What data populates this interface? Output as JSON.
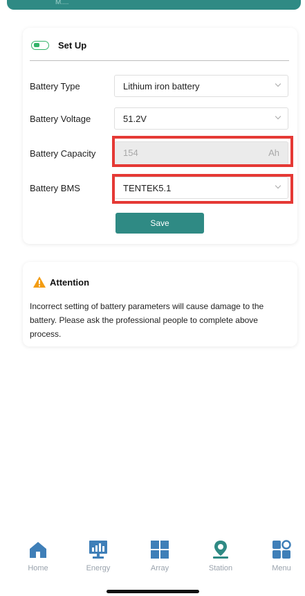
{
  "header": {
    "title": "M...."
  },
  "setup": {
    "title": "Set Up",
    "battery_type": {
      "label": "Battery Type",
      "value": "Lithium iron battery"
    },
    "battery_voltage": {
      "label": "Battery Voltage",
      "value": "51.2V"
    },
    "battery_capacity": {
      "label": "Battery Capacity",
      "value": "154",
      "unit": "Ah"
    },
    "battery_bms": {
      "label": "Battery BMS",
      "value": "TENTEK5.1"
    },
    "save_label": "Save"
  },
  "attention": {
    "title": "Attention",
    "text": "Incorrect setting of battery parameters will cause damage to the battery. Please ask the professional people to complete above process."
  },
  "nav": {
    "items": [
      {
        "label": "Home",
        "icon": "home-icon",
        "color": "#3f7fb8"
      },
      {
        "label": "Energy",
        "icon": "energy-icon",
        "color": "#3f7fb8"
      },
      {
        "label": "Array",
        "icon": "array-icon",
        "color": "#3f7fb8"
      },
      {
        "label": "Station",
        "icon": "station-icon",
        "color": "#2f8a84"
      },
      {
        "label": "Menu",
        "icon": "menu-icon",
        "color": "#3f7fb8"
      }
    ]
  },
  "colors": {
    "primary": "#2f8a84",
    "toggle_green": "#33b46a",
    "highlight_red": "#e53935",
    "warning_orange": "#f39c12",
    "nav_blue": "#3f7fb8"
  }
}
